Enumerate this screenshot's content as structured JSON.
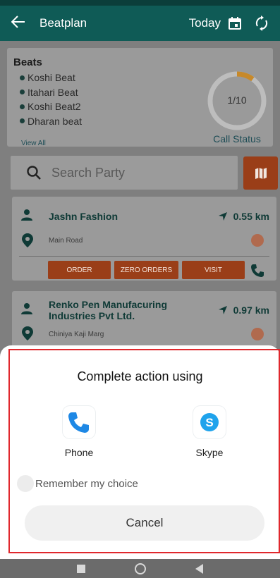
{
  "appbar": {
    "back_icon": "arrow-left-icon",
    "title": "Beatplan",
    "date_filter": "Today",
    "calendar_icon": "calendar-icon",
    "sync_icon": "sync-icon",
    "background": "#0f5b56"
  },
  "beats": {
    "heading": "Beats",
    "items": [
      "Koshi Beat",
      "Itahari Beat",
      "Koshi Beat2",
      "Dharan beat"
    ],
    "view_all": "View All",
    "call_status": {
      "label": "Call Status",
      "value_text": "1/10",
      "completed": 1,
      "total": 10,
      "progress_color": "#c7892a"
    }
  },
  "search": {
    "placeholder": "Search Party",
    "map_button_icon": "map-icon"
  },
  "parties": [
    {
      "name": "Jashn Fashion",
      "distance": "0.55 km",
      "address": "Main Road",
      "actions": [
        "ORDER",
        "ZERO ORDERS",
        "VISIT"
      ]
    },
    {
      "name": "Renko Pen Manufacuring Industries Pvt Ltd.",
      "distance": "0.97 km",
      "address": "Chiniya Kaji Marg"
    }
  ],
  "chooser": {
    "title": "Complete action using",
    "apps": [
      {
        "name": "Phone",
        "icon": "phone-app-icon",
        "color": "#1e88e5"
      },
      {
        "name": "Skype",
        "icon": "skype-app-icon",
        "color": "#1fa3ec"
      }
    ],
    "remember_label": "Remember my choice",
    "cancel_label": "Cancel"
  },
  "colors": {
    "accent": "#9a3e18",
    "teal": "#0f5b56",
    "highlight_outline": "#e0282d"
  }
}
